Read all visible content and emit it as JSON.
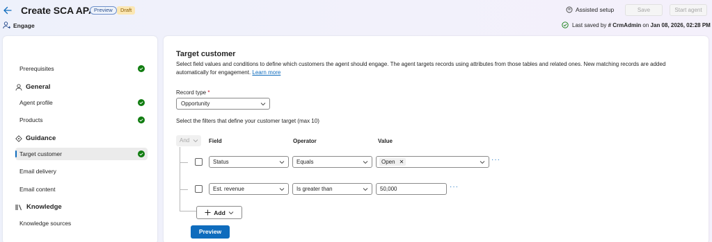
{
  "header": {
    "title": "Create SCA APAC",
    "badge_preview": "Preview",
    "badge_draft": "Draft",
    "assisted_setup": "Assisted setup",
    "save": "Save",
    "start_agent": "Start agent",
    "section": "Engage",
    "last_saved_prefix": "Last saved by",
    "last_saved_user": "# CrmAdmin",
    "last_saved_mid": "on",
    "last_saved_date": "Jan 08, 2026, 02:28 PM"
  },
  "sidebar": {
    "items": [
      {
        "label": "Prerequisites"
      },
      {
        "label": "Agent profile"
      },
      {
        "label": "Products"
      },
      {
        "label": "Target customer"
      },
      {
        "label": "Email delivery"
      },
      {
        "label": "Email content"
      },
      {
        "label": "Knowledge sources"
      }
    ],
    "groups": {
      "general": "General",
      "guidance": "Guidance",
      "knowledge": "Knowledge"
    }
  },
  "main": {
    "title": "Target customer",
    "description": "Select field values and conditions to define which customers the agent should engage. The agent targets records using attributes from those tables and related ones. New matching records are added automatically for engagement.",
    "learn_more": "Learn more",
    "record_type_label": "Record type",
    "record_type_required": "*",
    "record_type_value": "Opportunity",
    "filters_label": "Select the filters that define your customer target (max 10)",
    "and_label": "And",
    "columns": {
      "field": "Field",
      "operator": "Operator",
      "value": "Value"
    },
    "rows": [
      {
        "field": "Status",
        "operator": "Equals",
        "value": "Open"
      },
      {
        "field": "Est. revenue",
        "operator": "Is greater than",
        "value": "50,000"
      }
    ],
    "add_label": "Add",
    "preview_label": "Preview"
  },
  "colors": {
    "accent": "#0f6cbd",
    "success": "#107c10",
    "draft_bg": "#fbe7b4"
  }
}
